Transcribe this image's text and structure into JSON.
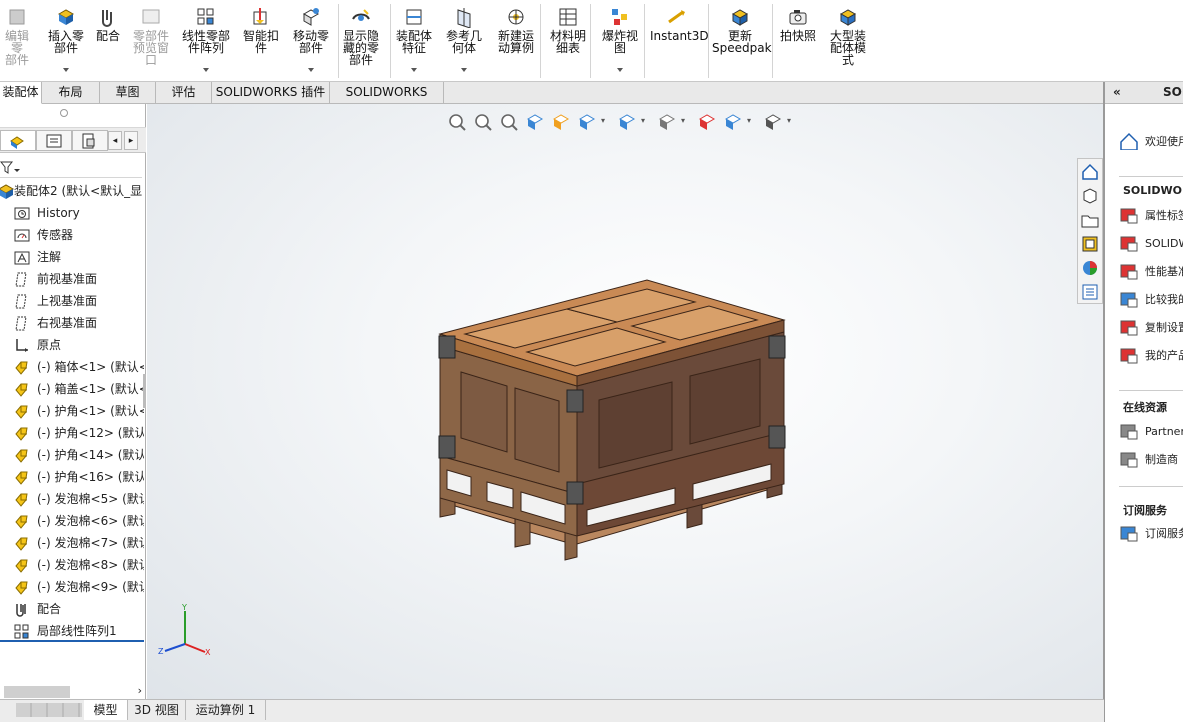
{
  "ribbon": {
    "buttons": [
      {
        "label": "编辑零\n部件",
        "icon": "edit-component-icon",
        "disabled": true
      },
      {
        "label": "插入零\n部件",
        "icon": "insert-component-icon"
      },
      {
        "label": "配合",
        "icon": "mate-icon"
      },
      {
        "label": "零部件\n预览窗\n口",
        "icon": "component-preview-icon",
        "disabled": true
      },
      {
        "label": "线性零部\n件阵列",
        "icon": "linear-pattern-icon"
      },
      {
        "label": "智能扣\n件",
        "icon": "smart-fastener-icon"
      },
      {
        "label": "移动零\n部件",
        "icon": "move-component-icon"
      },
      {
        "label": "显示隐\n藏的零\n部件",
        "icon": "show-hidden-icon"
      },
      {
        "label": "装配体\n特征",
        "icon": "assembly-feature-icon"
      },
      {
        "label": "参考几\n何体",
        "icon": "reference-geometry-icon"
      },
      {
        "label": "新建运\n动算例",
        "icon": "new-motion-study-icon"
      },
      {
        "label": "材料明\n细表",
        "icon": "bom-icon"
      },
      {
        "label": "爆炸视\n图",
        "icon": "exploded-view-icon"
      },
      {
        "label": "Instant3D",
        "icon": "instant3d-icon"
      },
      {
        "label": "更新\nSpeedpak",
        "icon": "speedpak-icon"
      },
      {
        "label": "拍快照",
        "icon": "snapshot-icon"
      },
      {
        "label": "大型装\n配体模\n式",
        "icon": "large-assembly-icon"
      }
    ]
  },
  "tabs": [
    "装配体",
    "布局",
    "草图",
    "评估",
    "SOLIDWORKS 插件",
    "SOLIDWORKS MBD"
  ],
  "tree": {
    "root": "装配体2 (默认<默认_显",
    "items": [
      {
        "label": "History",
        "icon": "history-icon"
      },
      {
        "label": "传感器",
        "icon": "sensor-icon"
      },
      {
        "label": "注解",
        "icon": "annotation-icon"
      },
      {
        "label": "前视基准面",
        "icon": "plane-icon"
      },
      {
        "label": "上视基准面",
        "icon": "plane-icon"
      },
      {
        "label": "右视基准面",
        "icon": "plane-icon"
      },
      {
        "label": "原点",
        "icon": "origin-icon"
      },
      {
        "label": "(-) 箱体<1> (默认<",
        "icon": "part-icon"
      },
      {
        "label": "(-) 箱盖<1> (默认<",
        "icon": "part-icon"
      },
      {
        "label": "(-) 护角<1> (默认<",
        "icon": "part-icon"
      },
      {
        "label": "(-) 护角<12> (默认",
        "icon": "part-icon"
      },
      {
        "label": "(-) 护角<14> (默认",
        "icon": "part-icon"
      },
      {
        "label": "(-) 护角<16> (默认",
        "icon": "part-icon"
      },
      {
        "label": "(-) 发泡棉<5> (默认",
        "icon": "part-icon"
      },
      {
        "label": "(-) 发泡棉<6> (默认",
        "icon": "part-icon"
      },
      {
        "label": "(-) 发泡棉<7> (默认",
        "icon": "part-icon"
      },
      {
        "label": "(-) 发泡棉<8> (默认",
        "icon": "part-icon"
      },
      {
        "label": "(-) 发泡棉<9> (默认",
        "icon": "part-icon"
      },
      {
        "label": "配合",
        "icon": "mates-icon"
      },
      {
        "label": "局部线性阵列1",
        "icon": "pattern-icon"
      }
    ]
  },
  "bottom_tabs": [
    "模型",
    "3D 视图",
    "运动算例 1"
  ],
  "triad": {
    "x": "X",
    "y": "Y",
    "z": "Z"
  },
  "right_panel": {
    "header": "SOL",
    "welcome": "欢迎使用",
    "section1": "SOLIDWORK",
    "section1_items": [
      "属性标签",
      "SOLIDW",
      "性能基准",
      "比较我的",
      "复制设置",
      "我的产品"
    ],
    "section2": "在线资源",
    "section2_items": [
      "Partner",
      "制造商"
    ],
    "section3": "订阅服务",
    "section3_items": [
      "订阅服务"
    ]
  },
  "colors": {
    "accent": "#1f5fb0",
    "crate_top": "#c98a55",
    "crate_front": "#6a4a3a",
    "crate_side": "#8a6446",
    "corner": "#555555"
  }
}
